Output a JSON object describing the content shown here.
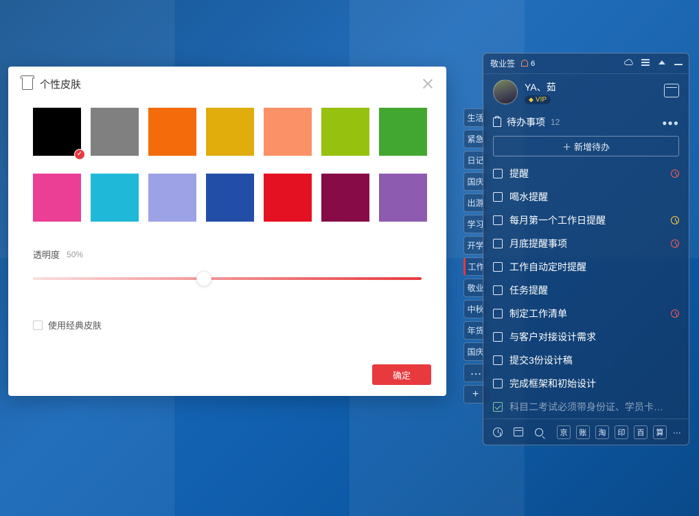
{
  "skin_dialog": {
    "title": "个性皮肤",
    "colors_row1": [
      "#000000",
      "#808080",
      "#f36b0a",
      "#e0ad0c",
      "#fb9167",
      "#96c10f",
      "#42a731"
    ],
    "colors_row2": [
      "#ea3f95",
      "#1fb8d8",
      "#9da1e6",
      "#224ea8",
      "#e41122",
      "#870b46",
      "#8d5bb0"
    ],
    "selected_index": 0,
    "opacity_label": "透明度",
    "opacity_value": "50%",
    "classic_label": "使用经典皮肤",
    "confirm_label": "确定"
  },
  "side_tabs": [
    {
      "label": "生活",
      "active": false
    },
    {
      "label": "紧急",
      "active": false
    },
    {
      "label": "日记",
      "active": false
    },
    {
      "label": "国庆",
      "active": false
    },
    {
      "label": "出游",
      "active": false
    },
    {
      "label": "学习",
      "active": false
    },
    {
      "label": "开学",
      "active": false
    },
    {
      "label": "工作",
      "active": true
    },
    {
      "label": "敬业",
      "active": false
    },
    {
      "label": "中秋",
      "active": false
    },
    {
      "label": "年货",
      "active": false
    },
    {
      "label": "国庆",
      "active": false
    }
  ],
  "panel": {
    "brand": "敬业签",
    "bell_count": "6",
    "user_name": "YA、茹",
    "vip_label": "VIP",
    "section_title": "待办事项",
    "section_count": "12",
    "add_label": "新增待办",
    "todos": [
      {
        "text": "提醒",
        "alarm": "red"
      },
      {
        "text": "喝水提醒",
        "alarm": null
      },
      {
        "text": "每月第一个工作日提醒",
        "alarm": "yel"
      },
      {
        "text": "月底提醒事项",
        "alarm": "red"
      },
      {
        "text": "工作自动定时提醒",
        "alarm": null
      },
      {
        "text": "任务提醒",
        "alarm": null
      },
      {
        "text": "制定工作清单",
        "alarm": "red"
      },
      {
        "text": "与客户对接设计需求",
        "alarm": null
      },
      {
        "text": "提交3份设计稿",
        "alarm": null
      },
      {
        "text": "完成框架和初始设计",
        "alarm": null
      },
      {
        "text": "科目二考试必须带身份证、学员卡、7...",
        "alarm": null,
        "done": true
      }
    ],
    "bottom_shortcuts": [
      "京",
      "账",
      "淘",
      "印",
      "百",
      "算"
    ]
  }
}
